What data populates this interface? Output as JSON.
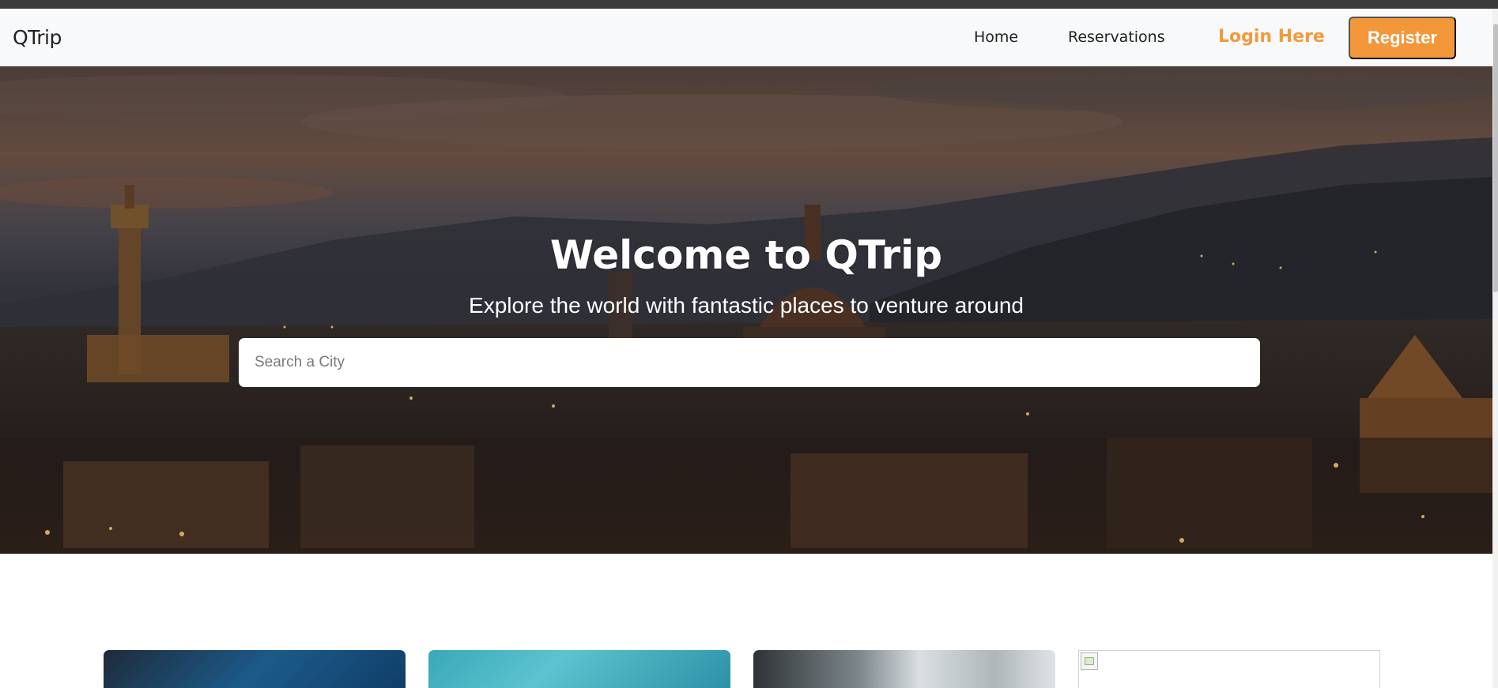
{
  "nav": {
    "brand": "QTrip",
    "home": "Home",
    "reservations": "Reservations",
    "login": "Login Here",
    "register": "Register"
  },
  "hero": {
    "title": "Welcome to QTrip",
    "subtitle": "Explore the world with fantastic places to venture around",
    "search_placeholder": "Search a City"
  },
  "colors": {
    "accent": "#f2973a",
    "navbar_bg": "#f8f9fa"
  },
  "cards": [
    {
      "image": "city-night-photo"
    },
    {
      "image": "ocean-water-photo"
    },
    {
      "image": "skyscraper-photo"
    },
    {
      "image": "broken-image-icon"
    }
  ]
}
